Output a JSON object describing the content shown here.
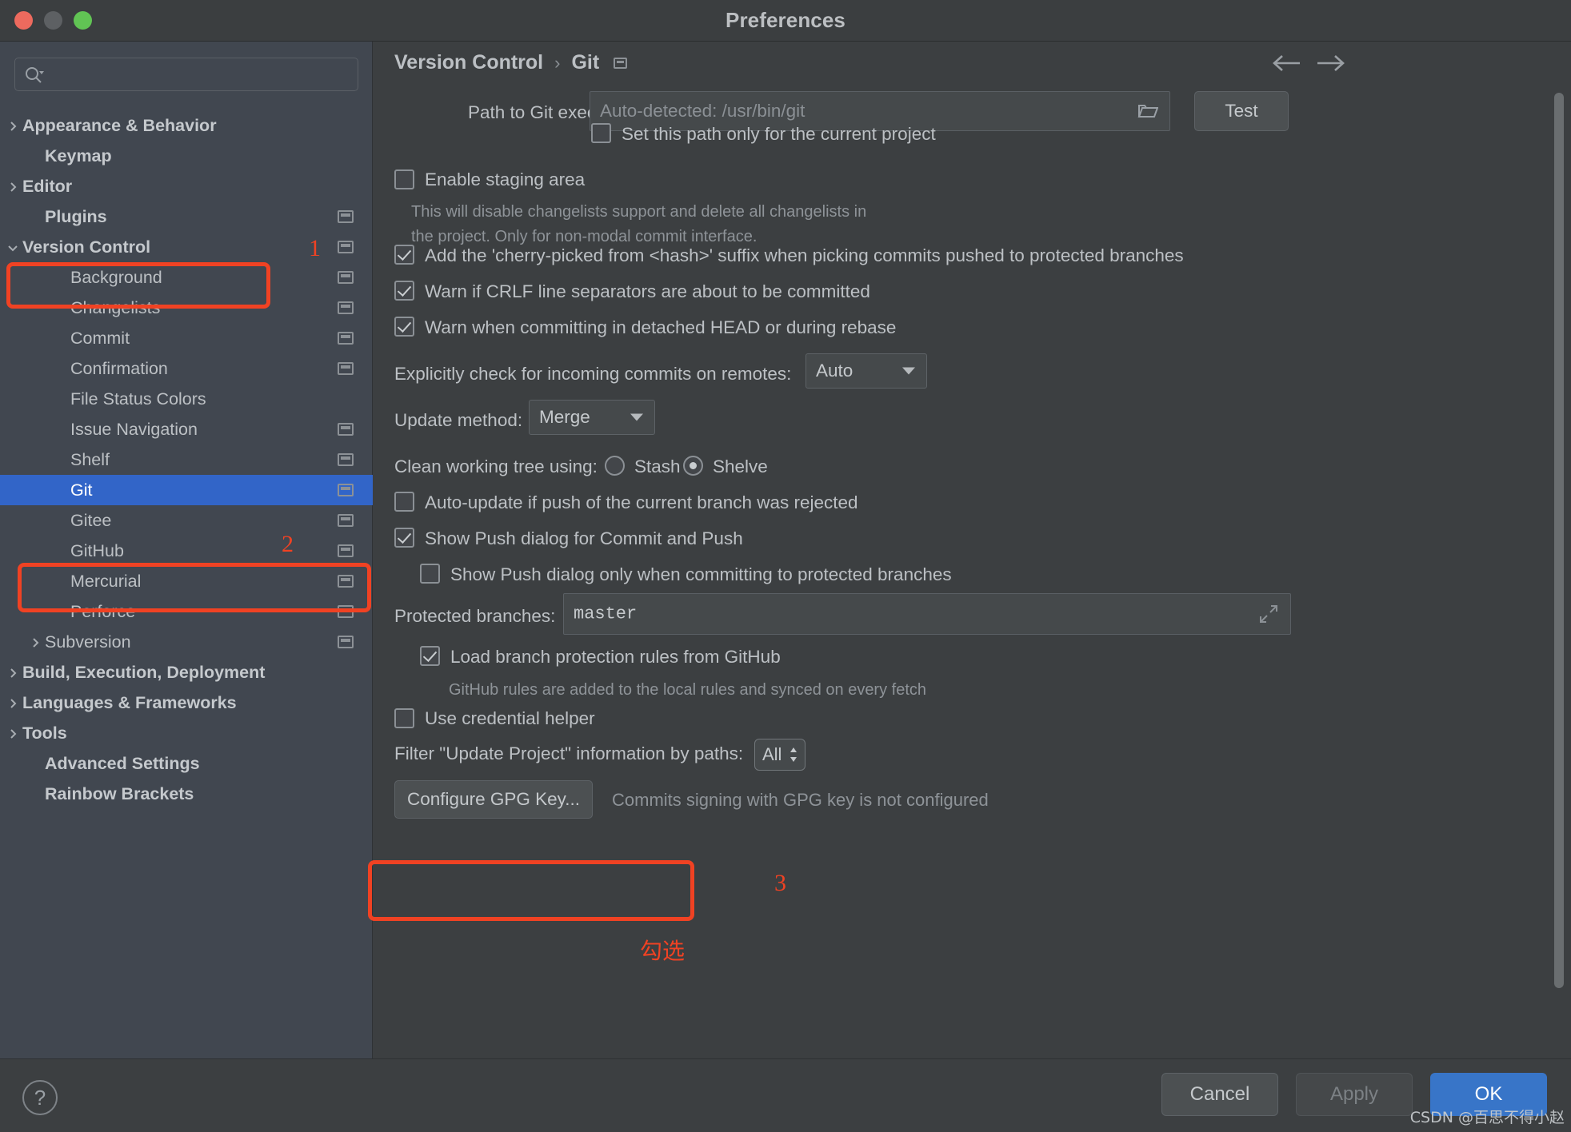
{
  "window": {
    "title": "Preferences",
    "traffic_lights": [
      "close-button",
      "minimize-button",
      "zoom-button"
    ]
  },
  "search": {
    "value": "",
    "placeholder": ""
  },
  "sidebar": {
    "items": [
      {
        "label": "Appearance & Behavior",
        "indent": 0,
        "arrow": "right",
        "bold": true,
        "cfg": false,
        "selected": false
      },
      {
        "label": "Keymap",
        "indent": 1,
        "arrow": "none",
        "bold": true,
        "cfg": false,
        "selected": false
      },
      {
        "label": "Editor",
        "indent": 0,
        "arrow": "right",
        "bold": true,
        "cfg": false,
        "selected": false
      },
      {
        "label": "Plugins",
        "indent": 1,
        "arrow": "none",
        "bold": true,
        "cfg": true,
        "selected": false
      },
      {
        "label": "Version Control",
        "indent": 0,
        "arrow": "down",
        "bold": true,
        "cfg": true,
        "selected": false
      },
      {
        "label": "Background",
        "indent": 2,
        "arrow": "none",
        "bold": false,
        "cfg": true,
        "selected": false
      },
      {
        "label": "Changelists",
        "indent": 2,
        "arrow": "none",
        "bold": false,
        "cfg": true,
        "selected": false
      },
      {
        "label": "Commit",
        "indent": 2,
        "arrow": "none",
        "bold": false,
        "cfg": true,
        "selected": false
      },
      {
        "label": "Confirmation",
        "indent": 2,
        "arrow": "none",
        "bold": false,
        "cfg": true,
        "selected": false
      },
      {
        "label": "File Status Colors",
        "indent": 2,
        "arrow": "none",
        "bold": false,
        "cfg": false,
        "selected": false
      },
      {
        "label": "Issue Navigation",
        "indent": 2,
        "arrow": "none",
        "bold": false,
        "cfg": true,
        "selected": false
      },
      {
        "label": "Shelf",
        "indent": 2,
        "arrow": "none",
        "bold": false,
        "cfg": true,
        "selected": false
      },
      {
        "label": "Git",
        "indent": 2,
        "arrow": "none",
        "bold": false,
        "cfg": true,
        "selected": true
      },
      {
        "label": "Gitee",
        "indent": 2,
        "arrow": "none",
        "bold": false,
        "cfg": true,
        "selected": false
      },
      {
        "label": "GitHub",
        "indent": 2,
        "arrow": "none",
        "bold": false,
        "cfg": true,
        "selected": false
      },
      {
        "label": "Mercurial",
        "indent": 2,
        "arrow": "none",
        "bold": false,
        "cfg": true,
        "selected": false
      },
      {
        "label": "Perforce",
        "indent": 2,
        "arrow": "none",
        "bold": false,
        "cfg": true,
        "selected": false
      },
      {
        "label": "Subversion",
        "indent": 1,
        "arrow": "right",
        "bold": false,
        "cfg": true,
        "selected": false
      },
      {
        "label": "Build, Execution, Deployment",
        "indent": 0,
        "arrow": "right",
        "bold": true,
        "cfg": false,
        "selected": false
      },
      {
        "label": "Languages & Frameworks",
        "indent": 0,
        "arrow": "right",
        "bold": true,
        "cfg": false,
        "selected": false
      },
      {
        "label": "Tools",
        "indent": 0,
        "arrow": "right",
        "bold": true,
        "cfg": false,
        "selected": false
      },
      {
        "label": "Advanced Settings",
        "indent": 1,
        "arrow": "none",
        "bold": true,
        "cfg": false,
        "selected": false
      },
      {
        "label": "Rainbow Brackets",
        "indent": 1,
        "arrow": "none",
        "bold": true,
        "cfg": false,
        "selected": false
      }
    ]
  },
  "breadcrumb": {
    "root": "Version Control",
    "separator": "›",
    "leaf": "Git"
  },
  "main": {
    "git_path_label": "Path to Git executable:",
    "git_path_placeholder": "Auto-detected: /usr/bin/git",
    "git_path_value": "",
    "test_button": "Test",
    "set_path_only_label": "Set this path only for the current project",
    "set_path_only_checked": false,
    "enable_staging_label": "Enable staging area",
    "enable_staging_checked": false,
    "enable_staging_hint_line1": "This will disable changelists support and delete all changelists in",
    "enable_staging_hint_line2": "the project. Only for non-modal commit interface.",
    "cherry_picked_label": "Add the 'cherry-picked from <hash>' suffix when picking commits pushed to protected branches",
    "cherry_picked_checked": true,
    "crlf_label": "Warn if CRLF line separators are about to be committed",
    "crlf_checked": true,
    "detached_head_label": "Warn when committing in detached HEAD or during rebase",
    "detached_head_checked": true,
    "incoming_commits_label": "Explicitly check for incoming commits on remotes:",
    "incoming_commits_value": "Auto",
    "update_method_label": "Update method:",
    "update_method_value": "Merge",
    "clean_tree_label": "Clean working tree using:",
    "clean_tree_option_stash": "Stash",
    "clean_tree_option_shelve": "Shelve",
    "clean_tree_selected": "Shelve",
    "auto_update_label": "Auto-update if push of the current branch was rejected",
    "auto_update_checked": false,
    "show_push_label": "Show Push dialog for Commit and Push",
    "show_push_checked": true,
    "show_push_protected_label": "Show Push dialog only when committing to protected branches",
    "show_push_protected_checked": false,
    "protected_branches_label": "Protected branches:",
    "protected_branches_value": "master",
    "load_rules_label": "Load branch protection rules from GitHub",
    "load_rules_checked": true,
    "load_rules_hint": "GitHub rules are added to the local rules and synced on every fetch",
    "credential_helper_label": "Use credential helper",
    "credential_helper_checked": false,
    "filter_paths_label": "Filter \"Update Project\" information by paths:",
    "filter_paths_value": "All",
    "gpg_button": "Configure GPG Key...",
    "gpg_status": "Commits signing with GPG key is not configured"
  },
  "footer": {
    "help": "?",
    "cancel": "Cancel",
    "apply": "Apply",
    "ok": "OK"
  },
  "annotations": {
    "accent_color": "#f04223",
    "num1": "1",
    "num2": "2",
    "num3": "3",
    "cn_note": "勾选"
  },
  "watermark": "CSDN @百思不得小赵"
}
